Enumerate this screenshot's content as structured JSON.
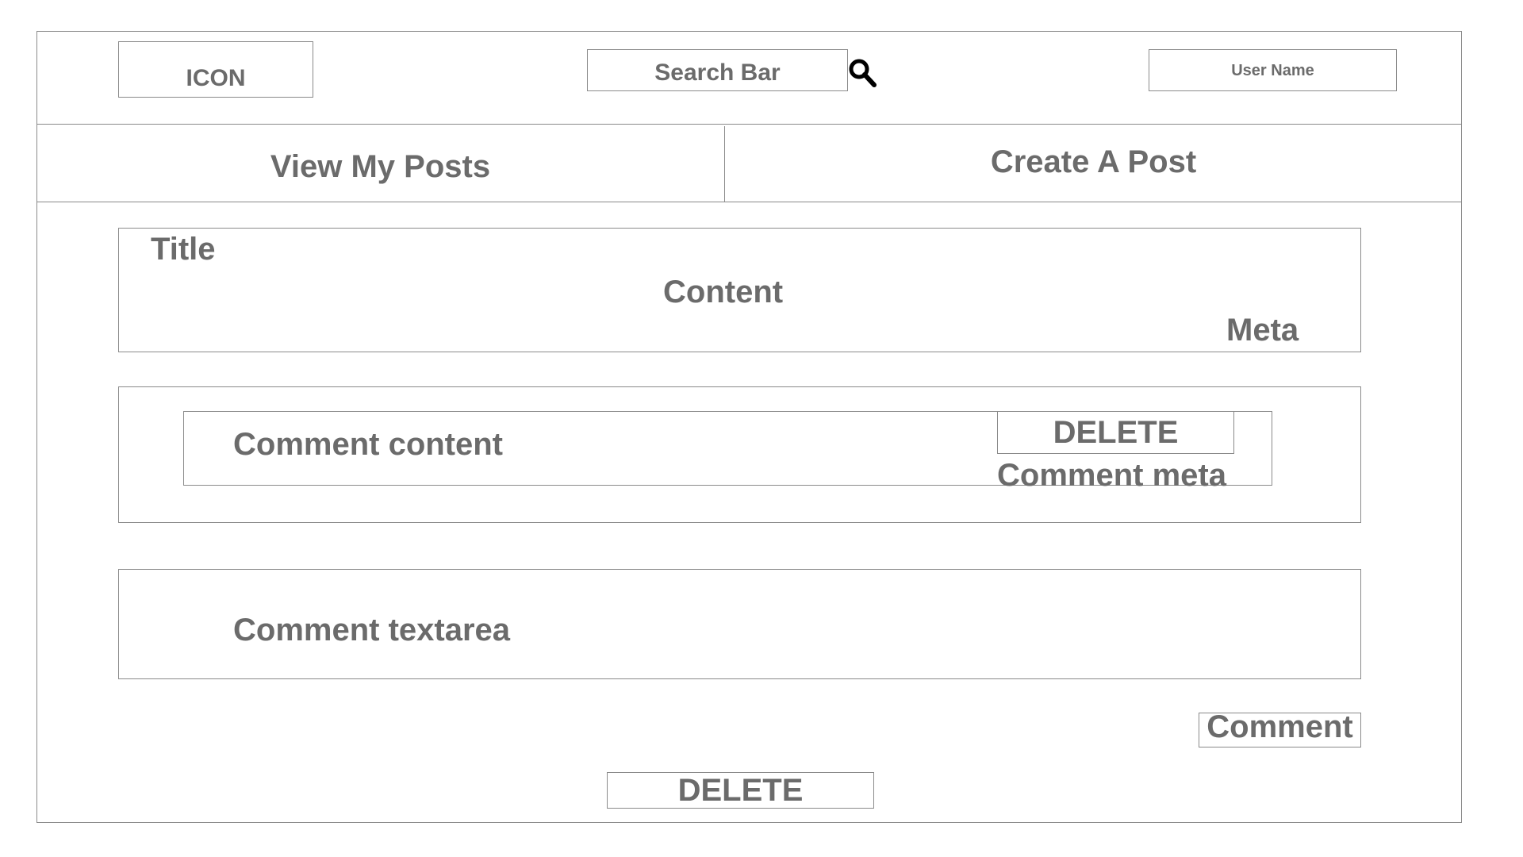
{
  "header": {
    "logo_label": "ICON",
    "search_label": "Search Bar",
    "search_icon": "magnifier-icon",
    "user_label": "User Name"
  },
  "nav": {
    "tabs": [
      {
        "label": "View My Posts"
      },
      {
        "label": "Create A Post"
      }
    ]
  },
  "post": {
    "title": "Title",
    "content": "Content",
    "meta": "Meta"
  },
  "comment": {
    "content": "Comment content",
    "delete_label": "DELETE",
    "meta": "Comment meta"
  },
  "comment_form": {
    "textarea_label": "Comment textarea",
    "submit_label": "Comment"
  },
  "post_actions": {
    "delete_label": "DELETE"
  },
  "colors": {
    "border": "#8a8a8a",
    "text": "#6b6b6b",
    "icon": "#000000"
  }
}
